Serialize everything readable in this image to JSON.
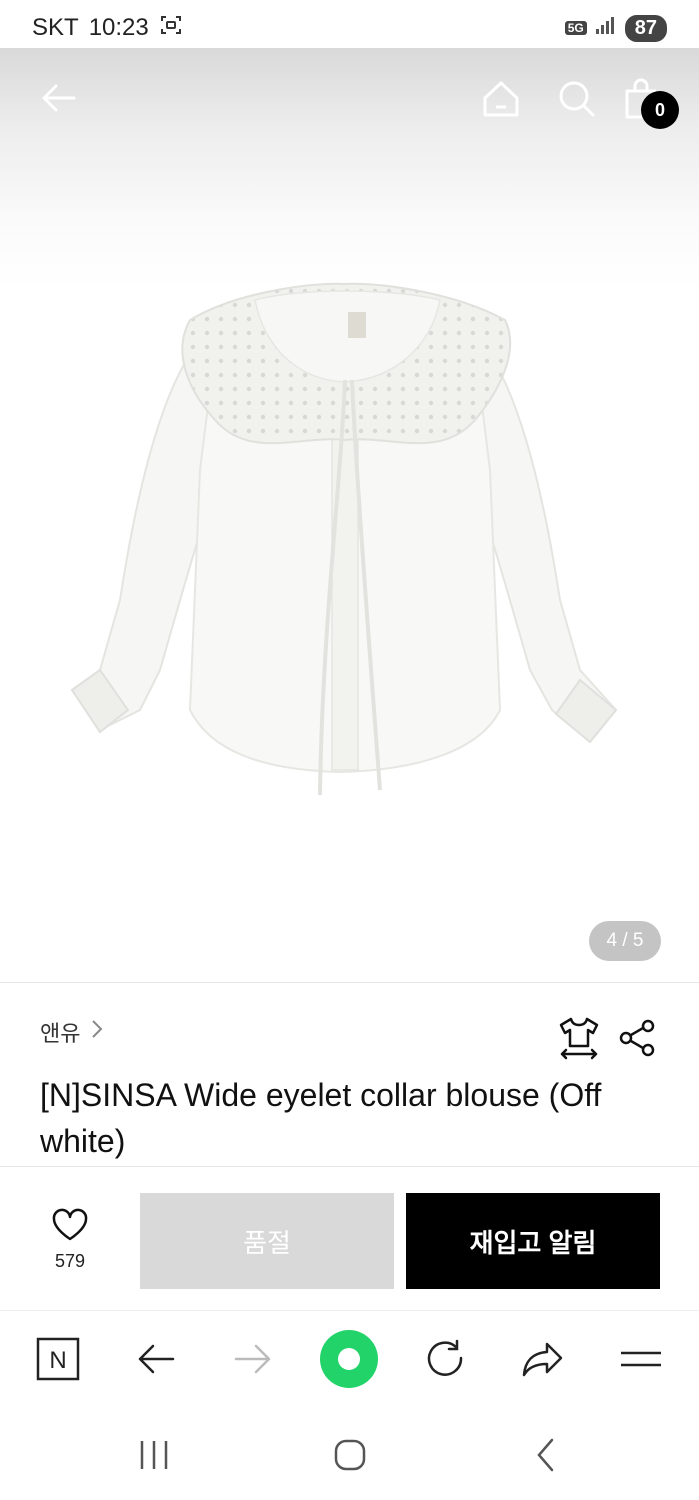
{
  "status_bar": {
    "carrier": "SKT",
    "time": "10:23",
    "network": "5G",
    "battery": "87"
  },
  "header": {
    "cart_count": "0",
    "icons": [
      "back-arrow-icon",
      "home-icon",
      "search-icon",
      "shopping-bag-icon"
    ]
  },
  "gallery": {
    "pager": "4 / 5",
    "image": "white-eyelet-collar-blouse"
  },
  "product": {
    "brand": "앤유",
    "title": "[N]SINSA Wide eyelet collar blouse (Off white)"
  },
  "actions": {
    "like_count": "579",
    "soldout_label": "품절",
    "restock_label": "재입고 알림"
  },
  "browser_toolbar": {
    "items": [
      "naver-home-icon",
      "back-icon",
      "forward-icon",
      "green-dot-icon",
      "refresh-icon",
      "share-icon",
      "menu-icon"
    ]
  },
  "colors": {
    "accent_green": "#22d36a",
    "button_black": "#000000",
    "button_disabled": "#d9d9d9"
  }
}
